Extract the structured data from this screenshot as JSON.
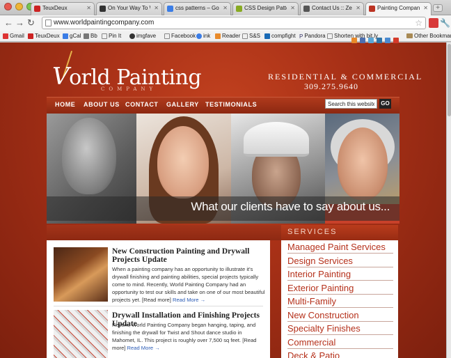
{
  "browser": {
    "tabs": [
      {
        "label": "TeuxDeux",
        "color": "#c22"
      },
      {
        "label": "On Your Way To Wonderl",
        "color": "#333"
      },
      {
        "label": "css patterns – Google Se",
        "color": "#3b7de6"
      },
      {
        "label": "CSS Design Patterns – HE",
        "color": "#8a2"
      },
      {
        "label": "Contact Us :: Zeller Digita",
        "color": "#555"
      },
      {
        "label": "Painting Company speci",
        "color": "#b32",
        "active": true
      }
    ],
    "url": "www.worldpaintingcompany.com",
    "bookmarks": [
      "Gmail",
      "TeuxDeux",
      "gCal",
      "Bb",
      "Pin It",
      "imgfave",
      "Facebook",
      "ink",
      "Reader",
      "S&S",
      "compfight",
      "Pandora",
      "Shorten with bit.ly"
    ],
    "other_bookmarks": "Other Bookmarks"
  },
  "site": {
    "logo_text": "orld Painting",
    "logo_v": "V",
    "logo_sub": "COMPANY",
    "tagline": "RESIDENTIAL & COMMERCIAL",
    "phone": "309.275.9640",
    "nav": [
      "HOME",
      "ABOUT US",
      "CONTACT",
      "GALLERY",
      "TESTIMONIALS"
    ],
    "search_value": "Search this website...",
    "search_button": "GO",
    "hero_caption": "What our clients have to say about us...",
    "services_heading": "SERVICES",
    "services": [
      "Managed Paint Services",
      "Design Services",
      "Interior Painting",
      "Exterior Painting",
      "Multi-Family",
      "New Construction",
      "Specialty Finishes",
      "Commercial",
      "Deck & Patio"
    ],
    "posts": [
      {
        "title": "New Construction Painting and Drywall Projects Update",
        "body": "When a painting company has an opportunity to illustrate it's drywall finishing and painting abilities, special projects typically come to mind. Recently, World Painting Company had an opportunity to test our skills and take on one of our most beautiful projects yet. [Read more]",
        "read_more": "Read More →"
      },
      {
        "title": "Drywall Installation and Finishing Projects Update",
        "body": "Recent, World Painting Company began hanging, taping, and finishing the drywall for Twist and Shout dance studio in Mahomet, IL. This project is roughly over 7,500 sq feet. [Read more]",
        "read_more": "Read More →"
      }
    ]
  }
}
